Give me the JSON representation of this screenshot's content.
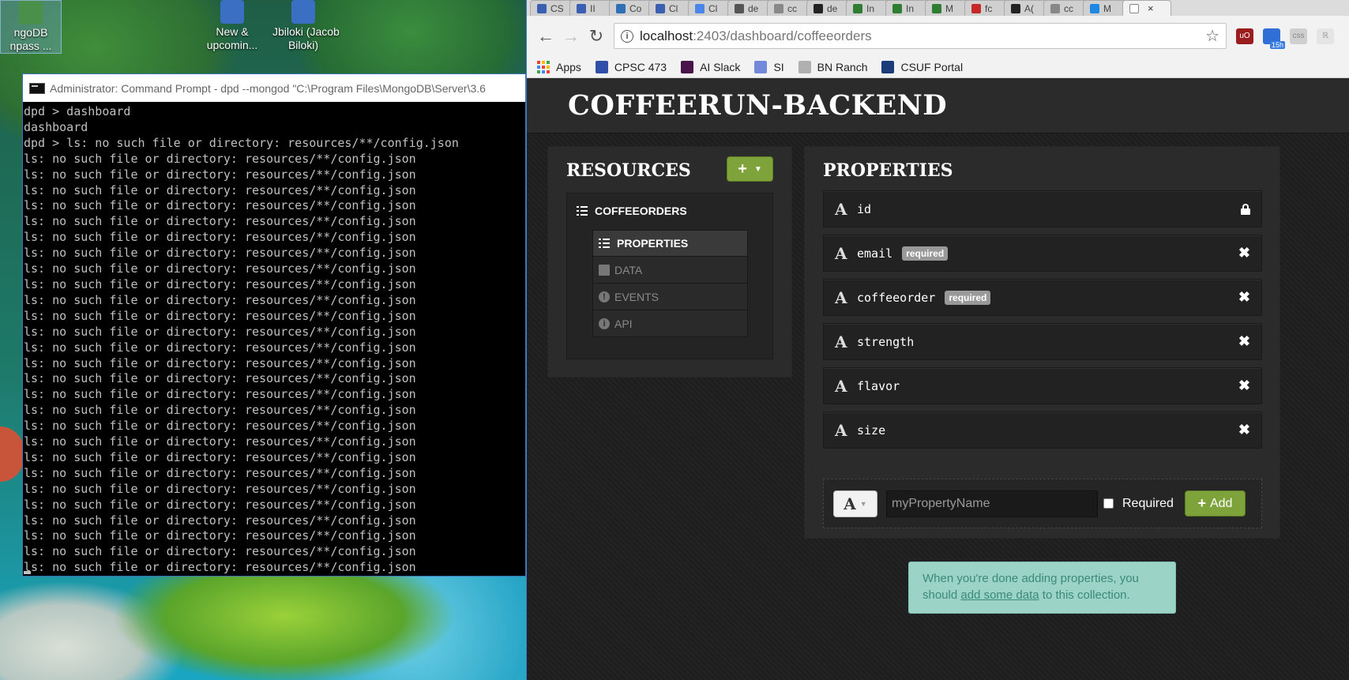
{
  "desktop": {
    "icons": [
      {
        "label": "ngoDB\nnpass ...",
        "color": "#4a8f4a",
        "selected": true
      },
      {
        "label": "New &\nupcomin...",
        "color": "#3a6fc4",
        "selected": false
      },
      {
        "label": "Jbiloki (Jacob\nBiloki)",
        "color": "#3a6fc4",
        "selected": false
      }
    ]
  },
  "cmd": {
    "title": "Administrator: Command Prompt - dpd  --mongod \"C:\\Program Files\\MongoDB\\Server\\3.6",
    "lines": [
      "dpd > dashboard",
      "dashboard",
      "dpd > ls: no such file or directory: resources/**/config.json",
      "ls: no such file or directory: resources/**/config.json",
      "ls: no such file or directory: resources/**/config.json",
      "ls: no such file or directory: resources/**/config.json",
      "ls: no such file or directory: resources/**/config.json",
      "ls: no such file or directory: resources/**/config.json",
      "ls: no such file or directory: resources/**/config.json",
      "ls: no such file or directory: resources/**/config.json",
      "ls: no such file or directory: resources/**/config.json",
      "ls: no such file or directory: resources/**/config.json",
      "ls: no such file or directory: resources/**/config.json",
      "ls: no such file or directory: resources/**/config.json",
      "ls: no such file or directory: resources/**/config.json",
      "ls: no such file or directory: resources/**/config.json",
      "ls: no such file or directory: resources/**/config.json",
      "ls: no such file or directory: resources/**/config.json",
      "ls: no such file or directory: resources/**/config.json",
      "ls: no such file or directory: resources/**/config.json",
      "ls: no such file or directory: resources/**/config.json",
      "ls: no such file or directory: resources/**/config.json",
      "ls: no such file or directory: resources/**/config.json",
      "ls: no such file or directory: resources/**/config.json",
      "ls: no such file or directory: resources/**/config.json",
      "ls: no such file or directory: resources/**/config.json",
      "ls: no such file or directory: resources/**/config.json",
      "ls: no such file or directory: resources/**/config.json",
      "ls: no such file or directory: resources/**/config.json",
      "ls: no such file or directory: resources/**/config.json"
    ]
  },
  "browser": {
    "tabs": [
      {
        "label": "CS",
        "color": "#3a5fb0"
      },
      {
        "label": "II",
        "color": "#3a5fb0"
      },
      {
        "label": "Co",
        "color": "#2f6fb5"
      },
      {
        "label": "Cl",
        "color": "#3a5fb0"
      },
      {
        "label": "Cl",
        "color": "#4a86e8"
      },
      {
        "label": "de",
        "color": "#555555"
      },
      {
        "label": "cc",
        "color": "#888888"
      },
      {
        "label": "de",
        "color": "#222222"
      },
      {
        "label": "In",
        "color": "#2e7d32"
      },
      {
        "label": "In",
        "color": "#2e7d32"
      },
      {
        "label": "M",
        "color": "#2e7d32"
      },
      {
        "label": "fc",
        "color": "#c62828"
      },
      {
        "label": "A(",
        "color": "#222222"
      },
      {
        "label": "cc",
        "color": "#888888"
      },
      {
        "label": "M",
        "color": "#1e88e5"
      }
    ],
    "active_tab_close": "×",
    "url_host": "localhost",
    "url_path": ":2403/dashboard/coffeeorders",
    "extension_badge": "15h",
    "bookmarks": [
      {
        "label": "Apps",
        "icon": "apps-grid-icon",
        "color": "#e53935"
      },
      {
        "label": "CPSC 473",
        "icon": "cpsc-icon",
        "color": "#2f4fa8"
      },
      {
        "label": "AI Slack",
        "icon": "slack-hash-icon",
        "color": "#4a154b"
      },
      {
        "label": "SI",
        "icon": "discord-icon",
        "color": "#7289da"
      },
      {
        "label": "BN Ranch",
        "icon": "ranch-icon",
        "color": "#b0b0b0"
      },
      {
        "label": "CSUF Portal",
        "icon": "csuf-icon",
        "color": "#1c3c7a"
      }
    ]
  },
  "dashboard": {
    "app_title": "COFFEERUN-BACKEND",
    "resources": {
      "title": "RESOURCES",
      "add_button": "+",
      "resource_name": "COFFEEORDERS",
      "subnav": [
        {
          "label": "PROPERTIES",
          "icon": "list-icon",
          "active": true
        },
        {
          "label": "DATA",
          "icon": "table-icon",
          "active": false
        },
        {
          "label": "EVENTS",
          "icon": "exclamation-circle-icon",
          "active": false
        },
        {
          "label": "API",
          "icon": "info-circle-icon",
          "active": false
        }
      ]
    },
    "properties": {
      "title": "PROPERTIES",
      "items": [
        {
          "type": "A",
          "name": "id",
          "required": "",
          "action": "lock"
        },
        {
          "type": "A",
          "name": "email",
          "required": "required",
          "action": "✖"
        },
        {
          "type": "A",
          "name": "coffeeorder",
          "required": "required",
          "action": "✖"
        },
        {
          "type": "A",
          "name": "strength",
          "required": "",
          "action": "✖"
        },
        {
          "type": "A",
          "name": "flavor",
          "required": "",
          "action": "✖"
        },
        {
          "type": "A",
          "name": "size",
          "required": "",
          "action": "✖"
        }
      ],
      "new_type": "A",
      "name_placeholder": "myPropertyName",
      "required_label": "Required",
      "add_label": "Add",
      "add_plus": "+"
    },
    "hint": {
      "before": "When you're done adding properties, you should ",
      "link": "add some data",
      "after": " to this collection."
    }
  }
}
